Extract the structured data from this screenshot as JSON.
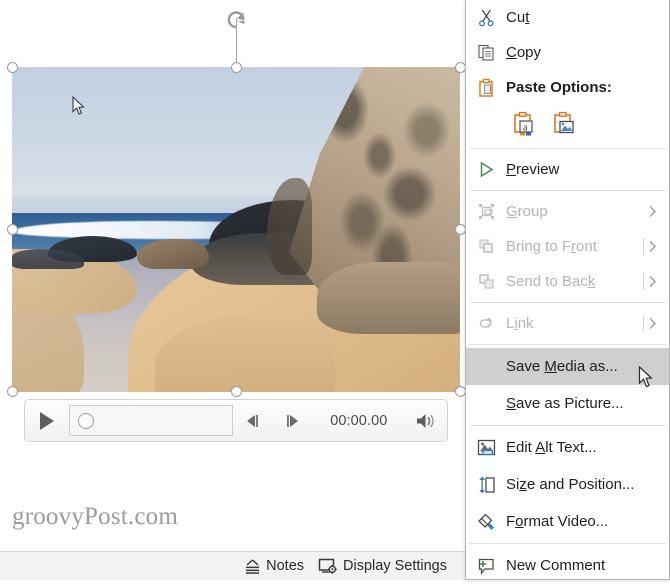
{
  "app": {
    "surface": "powerpoint-slide-editor"
  },
  "slide": {
    "watermark": "groovyPost.com",
    "selected_object": "video-placeholder"
  },
  "media_player": {
    "play_label": "Play",
    "play_icon": "play-triangle-icon",
    "progress_value": 0,
    "progress_icon": "progress-thumb-circle",
    "back_frame_icon": "previous-frame-icon",
    "forward_frame_icon": "next-frame-icon",
    "time": "00:00.00",
    "volume_icon": "volume-speaker-icon"
  },
  "status_bar": {
    "items": [
      {
        "label": "Notes",
        "icon": "notes-chevron-icon"
      },
      {
        "label": "Display Settings",
        "icon": "display-settings-icon"
      }
    ]
  },
  "context_menu": {
    "highlight_color": "#d0cece",
    "items": [
      {
        "id": "cut",
        "label": "Cut",
        "icon": "scissors-icon",
        "mnemonic": "t",
        "disabled": false,
        "submenu": false,
        "bold": false
      },
      {
        "id": "copy",
        "label": "Copy",
        "icon": "copy-pages-icon",
        "mnemonic": "C",
        "disabled": false,
        "submenu": false,
        "bold": false
      },
      {
        "id": "paste-options",
        "label": "Paste Options:",
        "icon": "clipboard-icon",
        "mnemonic": "",
        "disabled": false,
        "submenu": false,
        "bold": true
      },
      {
        "id": "preview",
        "label": "Preview",
        "icon": "preview-play-icon",
        "mnemonic": "P",
        "disabled": false,
        "submenu": false,
        "bold": false
      },
      {
        "id": "group",
        "label": "Group",
        "icon": "group-objects-icon",
        "mnemonic": "G",
        "disabled": true,
        "submenu": true,
        "bold": false
      },
      {
        "id": "bring-to-front",
        "label": "Bring to Front",
        "icon": "bring-front-icon",
        "mnemonic": "r",
        "disabled": true,
        "submenu": true,
        "bold": false
      },
      {
        "id": "send-to-back",
        "label": "Send to Back",
        "icon": "send-back-icon",
        "mnemonic": "k",
        "disabled": true,
        "submenu": true,
        "bold": false
      },
      {
        "id": "link",
        "label": "Link",
        "icon": "link-chain-icon",
        "mnemonic": "i",
        "disabled": true,
        "submenu": true,
        "bold": false
      },
      {
        "id": "save-media-as",
        "label": "Save Media as...",
        "icon": "",
        "mnemonic": "M",
        "disabled": false,
        "submenu": false,
        "bold": false,
        "highlighted": true
      },
      {
        "id": "save-as-picture",
        "label": "Save as Picture...",
        "icon": "",
        "mnemonic": "S",
        "disabled": false,
        "submenu": false,
        "bold": false
      },
      {
        "id": "edit-alt-text",
        "label": "Edit Alt Text...",
        "icon": "alt-text-image-icon",
        "mnemonic": "A",
        "disabled": false,
        "submenu": false,
        "bold": false
      },
      {
        "id": "size-and-position",
        "label": "Size and Position...",
        "icon": "size-position-icon",
        "mnemonic": "z",
        "disabled": false,
        "submenu": false,
        "bold": false
      },
      {
        "id": "format-video",
        "label": "Format Video...",
        "icon": "format-paint-icon",
        "mnemonic": "o",
        "disabled": false,
        "submenu": false,
        "bold": false
      },
      {
        "id": "new-comment",
        "label": "New Comment",
        "icon": "new-comment-icon",
        "mnemonic": "",
        "disabled": false,
        "submenu": false,
        "bold": false
      }
    ],
    "paste_options": [
      {
        "id": "paste-keep-text",
        "label": "Keep Text Only",
        "icon": "clipboard-text-icon"
      },
      {
        "id": "paste-picture",
        "label": "Picture",
        "icon": "clipboard-picture-icon"
      }
    ]
  }
}
